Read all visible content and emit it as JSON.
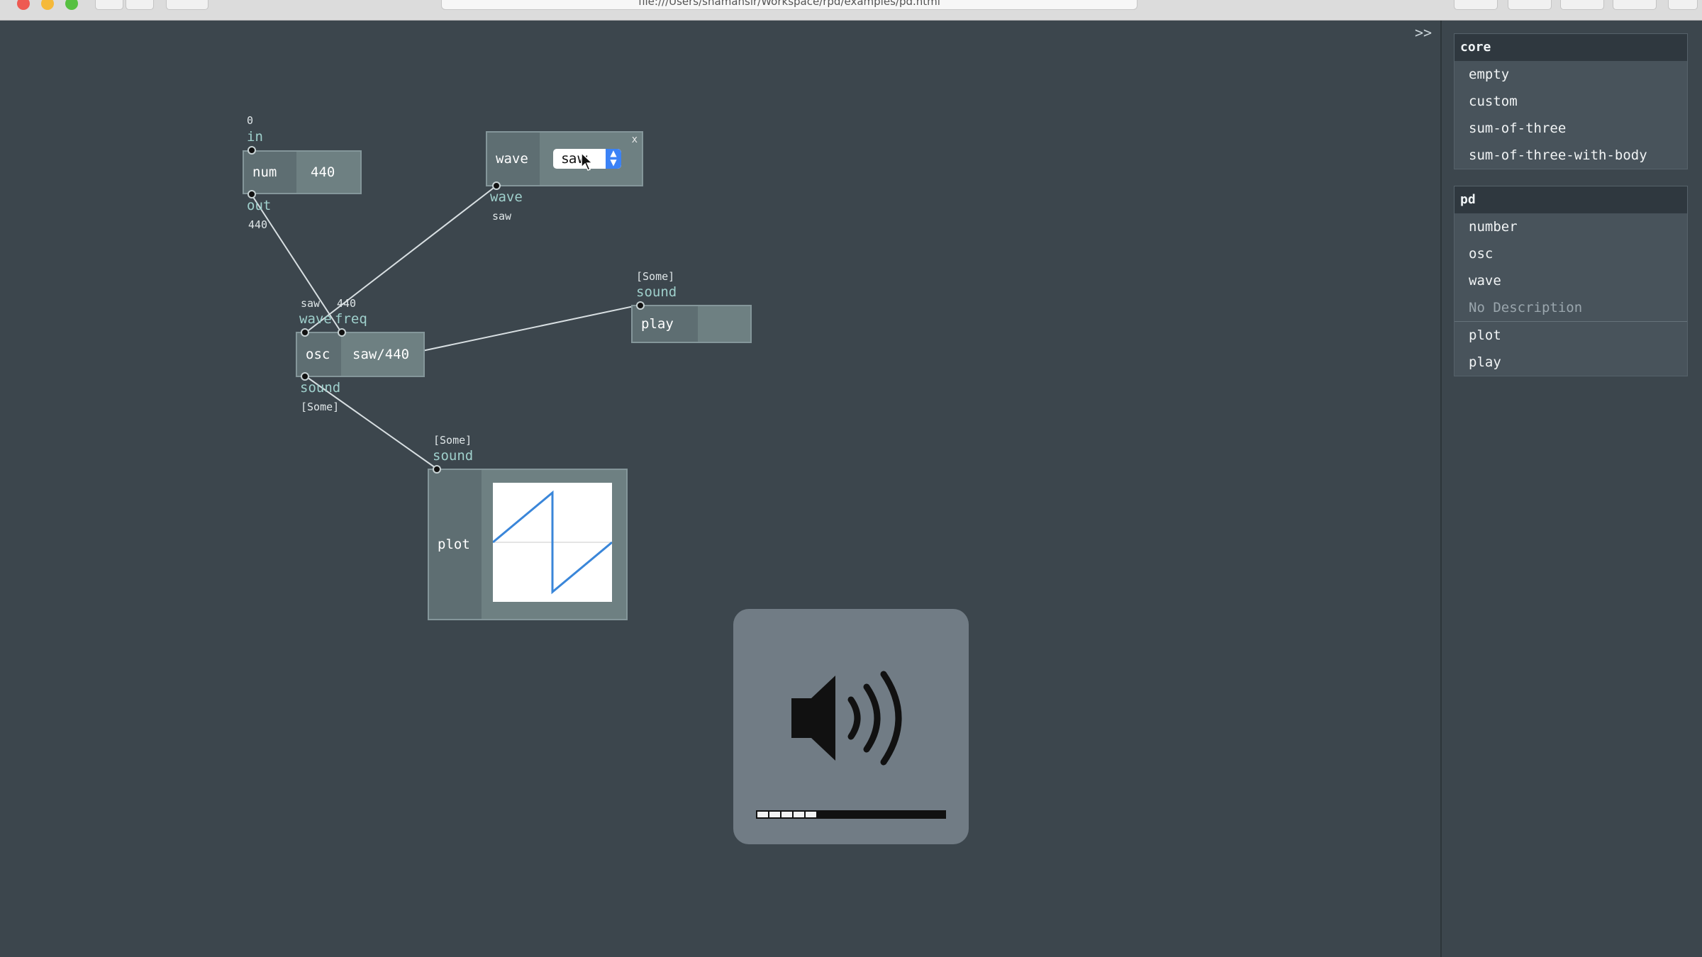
{
  "browser": {
    "url": "file:///Users/shamansir/Workspace/rpd/examples/pd.html"
  },
  "canvas": {
    "expander_label": ">>",
    "nodes": {
      "num": {
        "type": "num",
        "value": "440",
        "inlet_name": "in",
        "inlet_value": "0",
        "outlet_name": "out",
        "outlet_value": "440"
      },
      "wave": {
        "type": "wave",
        "selected": "saw",
        "close": "x",
        "outlet_name": "wave",
        "outlet_value": "saw"
      },
      "osc": {
        "type": "osc",
        "value": "saw/440",
        "inlet_wave_name": "wave",
        "inlet_wave_value": "saw",
        "inlet_freq_name": "freq",
        "inlet_freq_value": "440",
        "outlet_name": "sound",
        "outlet_value": "[Some]"
      },
      "play": {
        "type": "play",
        "inlet_name": "sound",
        "inlet_value": "[Some]"
      },
      "plot": {
        "type": "plot",
        "inlet_name": "sound",
        "inlet_value": "[Some]"
      }
    }
  },
  "sidebar": {
    "groups": [
      {
        "title": "core",
        "items": [
          "empty",
          "custom",
          "sum-of-three",
          "sum-of-three-with-body"
        ]
      },
      {
        "title": "pd",
        "items": [
          "number",
          "osc",
          "wave"
        ],
        "description": "No Description",
        "more_items": [
          "plot",
          "play"
        ]
      }
    ]
  },
  "volume_hud": {
    "icon": "speaker-volume-icon",
    "level": 0.31,
    "cells_filled": 5,
    "cells_total": 16
  },
  "colors": {
    "canvas_bg": "#3c464d",
    "node_bg": "#6e8082",
    "inlet_label": "#9fd0cc",
    "plot_line": "#3a86d9"
  }
}
